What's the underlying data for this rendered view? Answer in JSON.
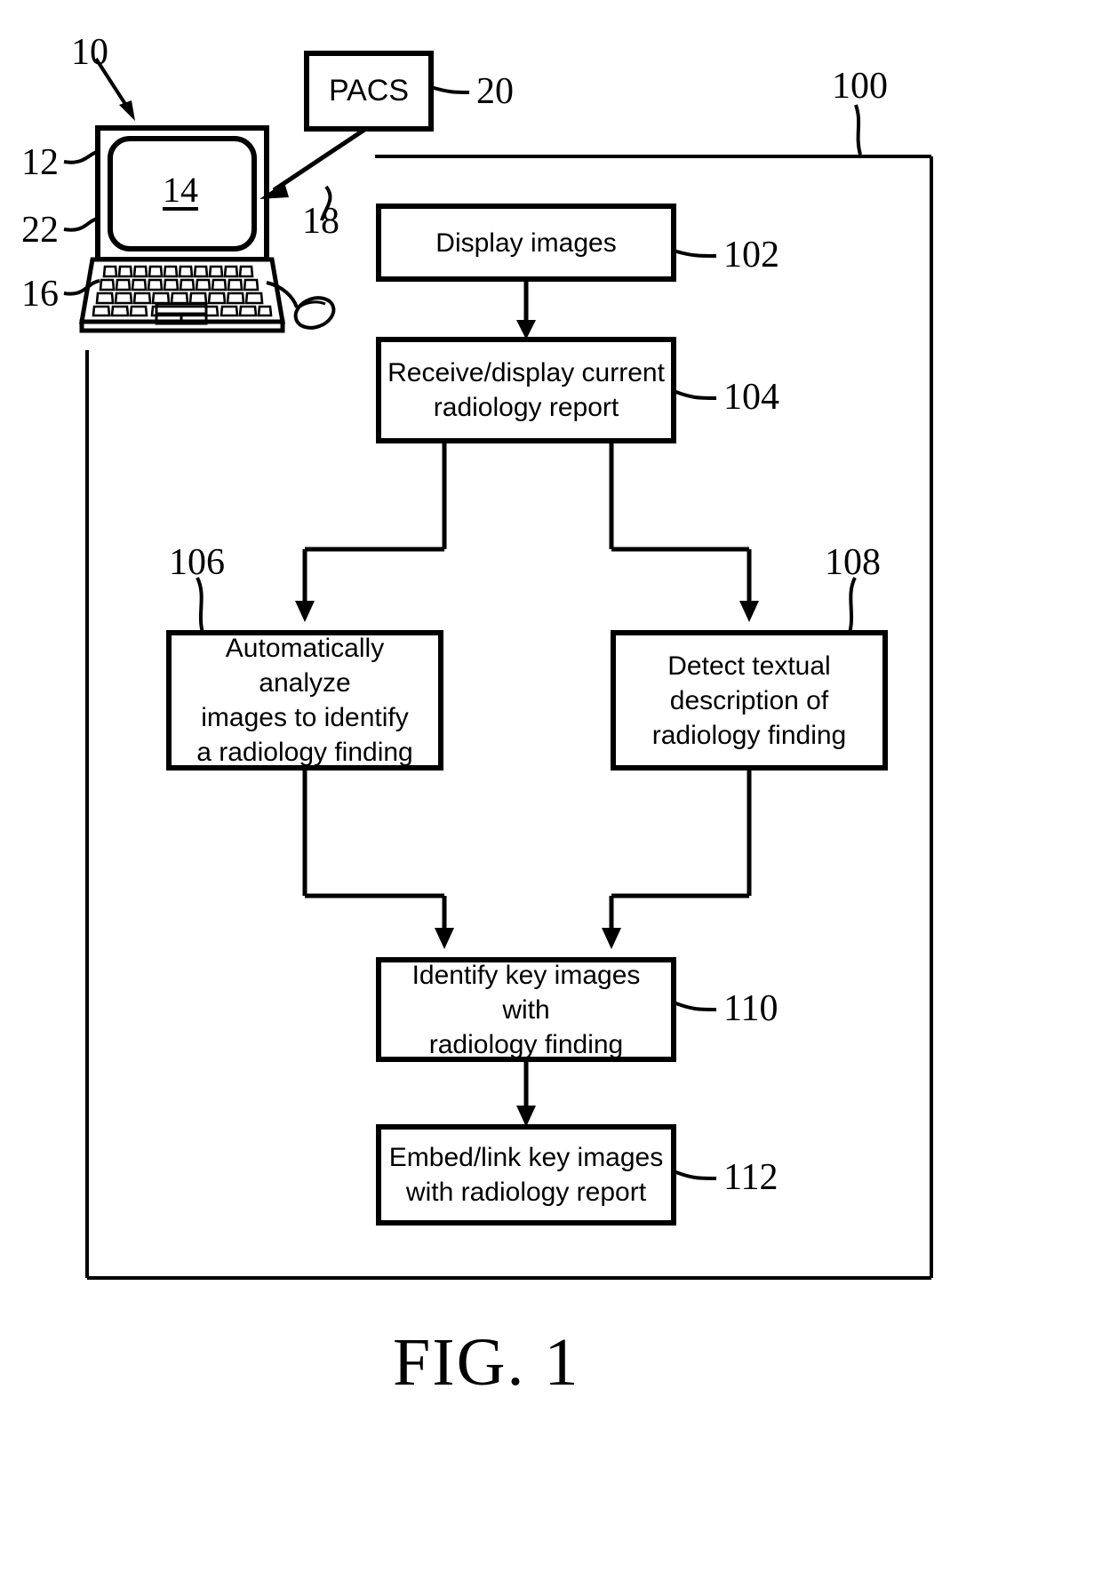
{
  "figure": {
    "caption": "FIG. 1",
    "system_ref": "10",
    "flow_ref": "100"
  },
  "workstation": {
    "device_ref": "10",
    "display_ref": "12",
    "screen_ref": "22",
    "keyboard_ref": "16",
    "screen_label": "14",
    "icons": {
      "laptop": "laptop-icon",
      "mouse": "mouse-icon",
      "keyboard": "keyboard-icon"
    }
  },
  "pacs": {
    "label": "PACS",
    "ref": "20",
    "connection_ref": "18"
  },
  "flowchart": {
    "steps": [
      {
        "id": "102",
        "ref": "102",
        "text": "Display images"
      },
      {
        "id": "104",
        "ref": "104",
        "text": "Receive/display current\nradiology report"
      },
      {
        "id": "106",
        "ref": "106",
        "text": "Automatically analyze\nimages to identify\na radiology finding"
      },
      {
        "id": "108",
        "ref": "108",
        "text": "Detect textual\ndescription of\nradiology finding"
      },
      {
        "id": "110",
        "ref": "110",
        "text": "Identify key images with\nradiology finding"
      },
      {
        "id": "112",
        "ref": "112",
        "text": "Embed/link key images\nwith radiology report"
      }
    ]
  },
  "colors": {
    "stroke": "#000000",
    "background": "#ffffff"
  }
}
